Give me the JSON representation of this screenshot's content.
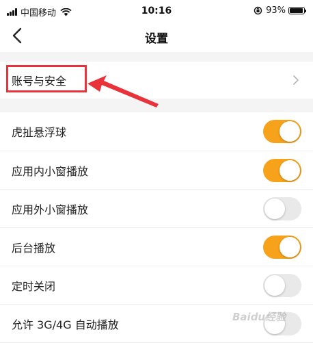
{
  "status_bar": {
    "carrier": "中国移动",
    "time": "10:16",
    "battery": "93%",
    "battery_level": 0.93
  },
  "nav": {
    "title": "设置"
  },
  "account_row": {
    "label": "账号与安全"
  },
  "settings": [
    {
      "label": "虎扯悬浮球",
      "on": true
    },
    {
      "label": "应用内小窗播放",
      "on": true
    },
    {
      "label": "应用外小窗播放",
      "on": false
    },
    {
      "label": "后台播放",
      "on": true
    },
    {
      "label": "定时关闭",
      "on": false
    },
    {
      "label": "允许 3G/4G 自动播放",
      "on": false
    }
  ],
  "colors": {
    "accent": "#f7a21b",
    "annotation": "#e8333a",
    "toggle_off": "#e9e9e9"
  },
  "watermark": "Baidu经验"
}
